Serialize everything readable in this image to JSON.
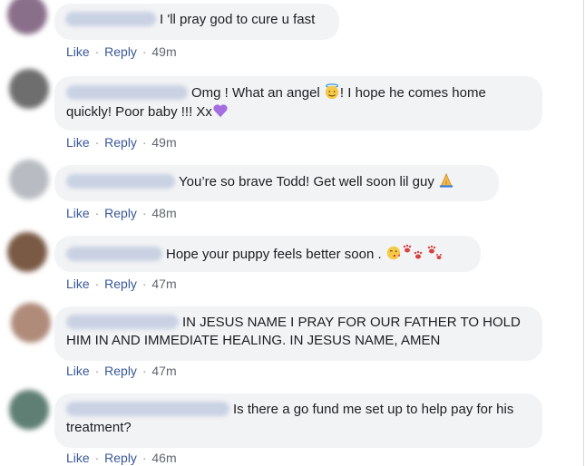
{
  "comments": [
    {
      "text_before": "I 'll pray god to cure u fast",
      "text_after": "",
      "emoji": "",
      "actions": {
        "like": "Like",
        "reply": "Reply",
        "dot": "·",
        "time": "49m"
      }
    },
    {
      "text_before": "Omg ! What an angel ",
      "text_after": "! I hope he comes home quickly! Poor baby !!! Xx",
      "emoji": "halo-face-emoji",
      "emoji2": "purple-heart-emoji",
      "actions": {
        "like": "Like",
        "reply": "Reply",
        "dot": "·",
        "time": "49m"
      }
    },
    {
      "text_before": "You’re so brave Todd! Get well soon lil guy ",
      "text_after": "",
      "emoji": "praying-hands-emoji",
      "actions": {
        "like": "Like",
        "reply": "Reply",
        "dot": "·",
        "time": "48m"
      }
    },
    {
      "text_before": "Hope your puppy feels better soon . ",
      "text_after": "",
      "emoji": "kiss-face-emoji",
      "emoji2": "paw-prints-emoji",
      "actions": {
        "like": "Like",
        "reply": "Reply",
        "dot": "·",
        "time": "47m"
      }
    },
    {
      "text_before": "IN JESUS NAME I PRAY FOR OUR FATHER TO HOLD HIM IN AND IMMEDIATE HEALING. IN JESUS NAME, AMEN",
      "text_after": "",
      "emoji": "",
      "actions": {
        "like": "Like",
        "reply": "Reply",
        "dot": "·",
        "time": "47m"
      }
    },
    {
      "text_before": "Is there a go fund me set up to help pay for his treatment?",
      "text_after": "",
      "emoji": "",
      "actions": {
        "like": "Like",
        "reply": "Reply",
        "dot": "·",
        "time": "46m"
      }
    }
  ],
  "colors": {
    "bubble": "#f2f3f5",
    "link": "#385898",
    "meta": "#606770",
    "text": "#1c1e21"
  }
}
